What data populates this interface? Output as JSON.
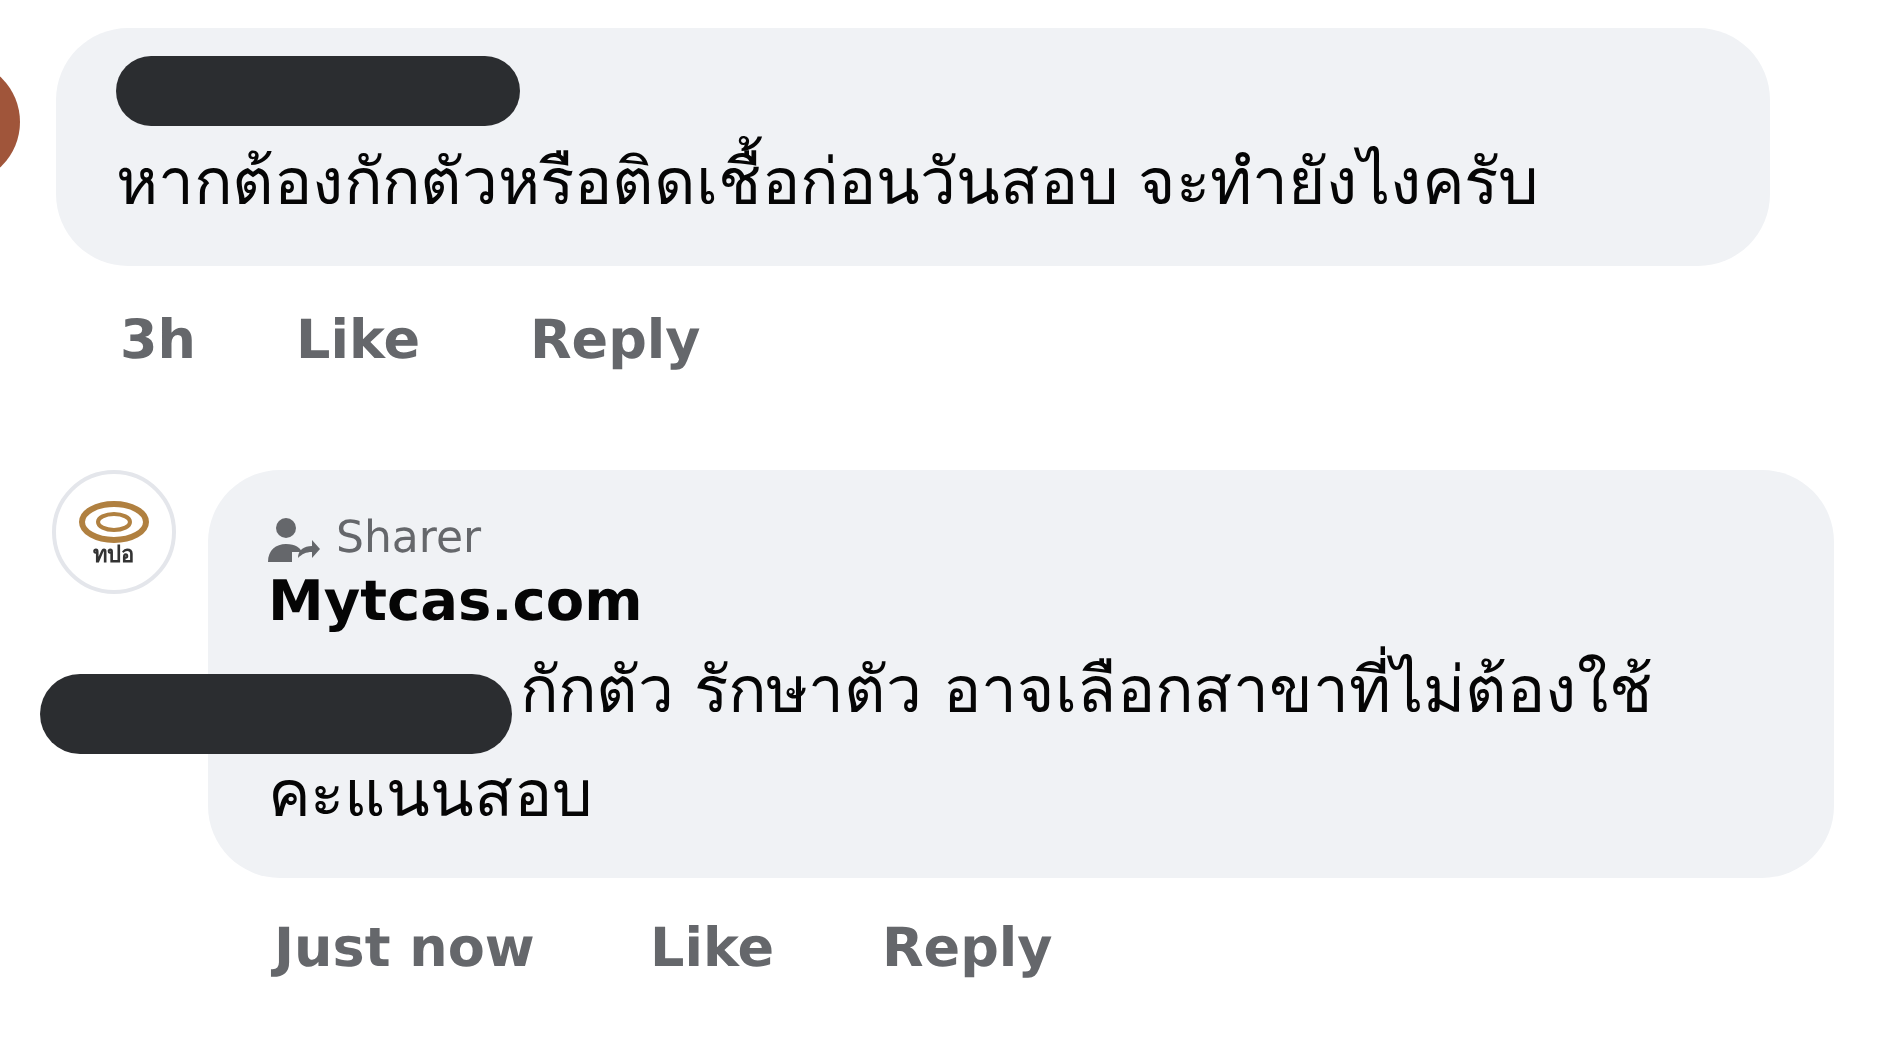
{
  "comments": [
    {
      "kind": "question",
      "author_hidden": true,
      "text": "หากต้องกักตัวหรือติดเชื้อก่อนวันสอบ จะทำยังไงครับ",
      "time": "3h",
      "actions": [
        "Like",
        "Reply"
      ]
    },
    {
      "kind": "page_reply",
      "badge": "Sharer",
      "author": "Mytcas.com",
      "logo_text": "ทปอ",
      "mention_hidden": true,
      "text_lines": [
        "กักตัว รักษาตัว อาจเลือกสาขาที่ไม่ต้องใช้",
        "คะแนนสอบ"
      ],
      "time": "Just now",
      "actions": [
        "Like",
        "Reply"
      ]
    }
  ]
}
